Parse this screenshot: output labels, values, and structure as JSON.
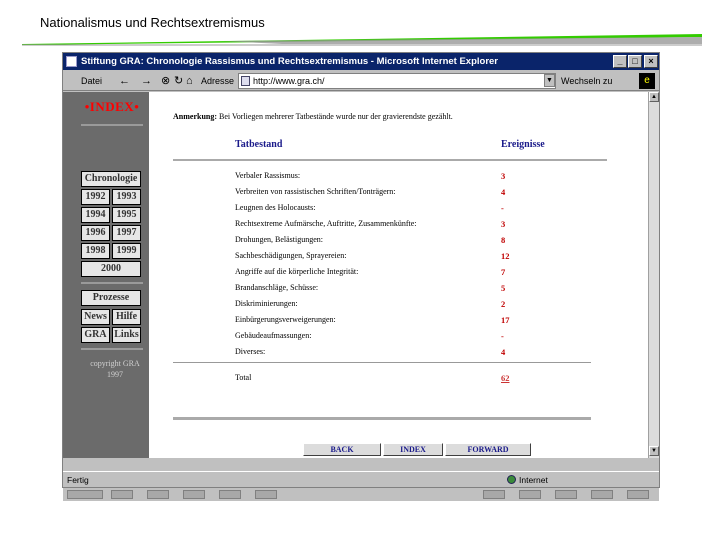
{
  "slide": {
    "title": "Nationalismus und Rechtsextremismus"
  },
  "colors": {
    "rule_green": "#33cc00",
    "rule_gray": "#999999",
    "titlebar": "#0a246a",
    "sidebar": "#6b6b6b",
    "value_red": "#c00000",
    "heading_blue": "#1a1a8a"
  },
  "browser": {
    "title": "Stiftung GRA: Chronologie Rassismus und Rechtsextremismus - Microsoft Internet Explorer",
    "buttons": {
      "minimize": "_",
      "maximize": "□",
      "close": "×"
    },
    "toolbar": {
      "file_menu": "Datei",
      "back_arrow": "←",
      "forward_arrow": "→",
      "stop": "⊗",
      "refresh": "↻",
      "home": "⌂",
      "address_label": "Adresse",
      "address_value": "http://www.gra.ch/",
      "go_label": "Wechseln zu"
    },
    "status": {
      "text": "Fertig",
      "zone": "Internet"
    }
  },
  "sidebar": {
    "logo": "•INDEX•",
    "chronologie": "Chronologie",
    "years": [
      "1992",
      "1993",
      "1994",
      "1995",
      "1996",
      "1997",
      "1998",
      "1999"
    ],
    "year_2000": "2000",
    "prozesse": "Prozesse",
    "news": "News",
    "hilfe": "Hilfe",
    "gra": "GRA",
    "links": "Links",
    "copyright_line1": "copyright GRA",
    "copyright_line2": "1997"
  },
  "table": {
    "note_bold": "Anmerkung:",
    "note_text": "Bei Vorliegen mehrerer Tatbestände wurde nur der gravierendste gezählt.",
    "header_tatbestand": "Tatbestand",
    "header_ereignisse": "Ereignisse",
    "rows": [
      {
        "label": "Verbaler Rassismus:",
        "value": "3"
      },
      {
        "label": "Verbreiten von rassistischen Schriften/Tonträgern:",
        "value": "4"
      },
      {
        "label": "Leugnen des Holocausts:",
        "value": "-"
      },
      {
        "label": "Rechtsextreme Aufmärsche, Auftritte, Zusammenkünfte:",
        "value": "3"
      },
      {
        "label": "Drohungen, Belästigungen:",
        "value": "8"
      },
      {
        "label": "Sachbeschädigungen, Sprayereien:",
        "value": "12"
      },
      {
        "label": "Angriffe auf die körperliche Integrität:",
        "value": "7"
      },
      {
        "label": "Brandanschläge, Schüsse:",
        "value": "5"
      },
      {
        "label": "Diskriminierungen:",
        "value": "2"
      },
      {
        "label": "Einbürgerungsverweigerungen:",
        "value": "17"
      },
      {
        "label": "Gebäudeaufmassungen:",
        "value": "-"
      },
      {
        "label": "Diverses:",
        "value": "4"
      }
    ],
    "total_label": "Total",
    "total_value": "62"
  },
  "nav": {
    "back": "BACK",
    "index": "INDEX",
    "forward": "FORWARD"
  }
}
